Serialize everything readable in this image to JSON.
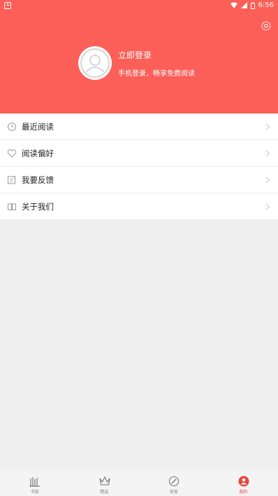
{
  "status_bar": {
    "time": "6:56"
  },
  "header": {
    "login_title": "立即登录",
    "login_subtitle": "手机登录，畅享免费阅读"
  },
  "menu": {
    "items": [
      {
        "label": "最近阅读",
        "icon": "clock-icon"
      },
      {
        "label": "阅读偏好",
        "icon": "heart-icon"
      },
      {
        "label": "我要反馈",
        "icon": "edit-icon"
      },
      {
        "label": "关于我们",
        "icon": "book-icon"
      }
    ]
  },
  "tabbar": {
    "tabs": [
      {
        "label": "书架",
        "icon": "bookshelf-icon",
        "active": false
      },
      {
        "label": "精选",
        "icon": "crown-icon",
        "active": false
      },
      {
        "label": "发现",
        "icon": "compass-icon",
        "active": false
      },
      {
        "label": "我的",
        "icon": "user-icon",
        "active": true
      }
    ]
  },
  "colors": {
    "accent": "#fb5f58",
    "active_tab": "#e8463e",
    "background": "#efefef"
  }
}
